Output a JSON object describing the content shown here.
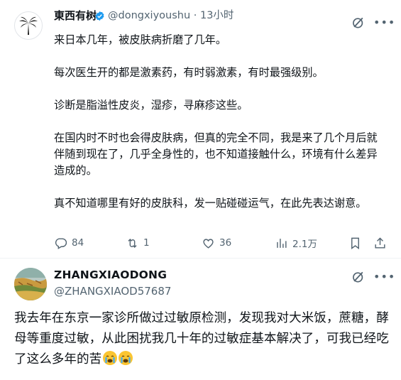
{
  "tweet": {
    "author_name": "東西有树",
    "handle": "@dongxiyoushu",
    "separator": "·",
    "time": "13小时",
    "paragraphs": [
      "来日本几年，被皮肤病折磨了几年。",
      "每次医生开的都是激素药，有时弱激素，有时最强级别。",
      "诊断是脂溢性皮炎，湿疹，寻麻疹这些。",
      "在国内时不时也会得皮肤病，但真的完全不同，我是来了几个月后就伴随到现在了，几乎全身性的，也不知道接触什么，环境有什么差异造成的。",
      "真不知道哪里有好的皮肤科，发一贴碰碰运气，在此先表达谢意。"
    ],
    "actions": {
      "replies": "84",
      "retweets": "1",
      "likes": "36",
      "views": "2.1万"
    },
    "icons": [
      "palm-tree-avatar",
      "verified-badge-icon",
      "grok-icon",
      "more-icon",
      "reply-icon",
      "retweet-icon",
      "like-icon",
      "views-icon",
      "bookmark-icon",
      "share-icon"
    ]
  },
  "reply": {
    "author_name": "ZHANGXIAODONG",
    "handle": "@ZHANGXIAOD57687",
    "text": "我去年在东京一家诊所做过过敏原检测，发现我对大米饭，蔗糖，酵母等重度过敏，从此困扰我几十年的过敏症基本解决了，可我已经吃了这么多年的苦",
    "emojis": [
      "crying-face-emoji",
      "crying-face-emoji"
    ]
  },
  "colors": {
    "text": "#0f1419",
    "secondary": "#536471",
    "verified": "#1d9bf0",
    "divider": "#eff3f4"
  }
}
